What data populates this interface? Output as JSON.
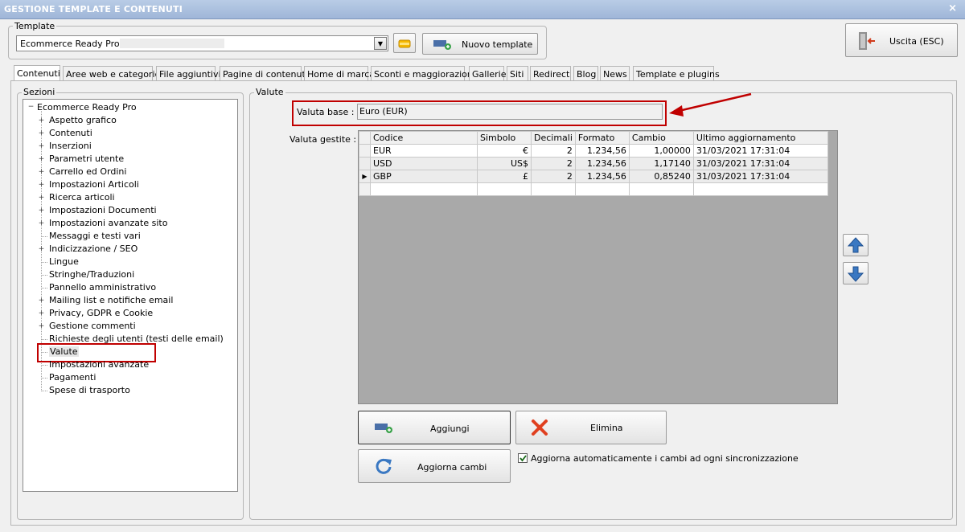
{
  "window": {
    "title": "GESTIONE TEMPLATE E CONTENUTI",
    "close_glyph": "×"
  },
  "template": {
    "group_label": "Template",
    "selected": "Ecommerce Ready Pro",
    "new_label": "Nuovo template",
    "exit_label": "Uscita (ESC)"
  },
  "tabs": [
    "Contenuti",
    "Aree web e categorie",
    "File aggiuntivi",
    "Pagine di contenuti",
    "Home di marca",
    "Sconti e maggiorazioni",
    "Gallerie",
    "Siti",
    "Redirect",
    "Blog",
    "News",
    "Template e plugins"
  ],
  "active_tab": "Contenuti",
  "sections": {
    "label": "Sezioni",
    "root": "Ecommerce Ready Pro",
    "items": [
      {
        "label": "Aspetto grafico",
        "expandable": true
      },
      {
        "label": "Contenuti",
        "expandable": true
      },
      {
        "label": "Inserzioni",
        "expandable": true
      },
      {
        "label": "Parametri utente",
        "expandable": true
      },
      {
        "label": "Carrello ed Ordini",
        "expandable": true
      },
      {
        "label": "Impostazioni Articoli",
        "expandable": true
      },
      {
        "label": "Ricerca articoli",
        "expandable": true
      },
      {
        "label": "Impostazioni Documenti",
        "expandable": true
      },
      {
        "label": "Impostazioni avanzate sito",
        "expandable": true
      },
      {
        "label": "Messaggi e testi vari",
        "expandable": false
      },
      {
        "label": "Indicizzazione / SEO",
        "expandable": true
      },
      {
        "label": "Lingue",
        "expandable": false
      },
      {
        "label": "Stringhe/Traduzioni",
        "expandable": false
      },
      {
        "label": "Pannello amministrativo",
        "expandable": false
      },
      {
        "label": "Mailing list e notifiche email",
        "expandable": true
      },
      {
        "label": "Privacy, GDPR e Cookie",
        "expandable": true
      },
      {
        "label": "Gestione commenti",
        "expandable": true
      },
      {
        "label": "Richieste degli utenti (testi delle email)",
        "expandable": false
      },
      {
        "label": "Valute",
        "expandable": false,
        "selected": true
      },
      {
        "label": "Impostazioni avanzate",
        "expandable": false
      },
      {
        "label": "Pagamenti",
        "expandable": false
      },
      {
        "label": "Spese di trasporto",
        "expandable": false
      }
    ]
  },
  "valute": {
    "group_label": "Valute",
    "base_label": "Valuta base :",
    "base_value": "Euro (EUR)",
    "managed_label": "Valuta gestite :",
    "columns": [
      "Codice",
      "Simbolo",
      "Decimali",
      "Formato",
      "Cambio",
      "Ultimo aggiornamento"
    ],
    "rows": [
      {
        "codice": "EUR",
        "simbolo": "€",
        "decimali": "2",
        "formato": "1.234,56",
        "cambio": "1,00000",
        "aggiornamento": "31/03/2021 17:31:04"
      },
      {
        "codice": "USD",
        "simbolo": "US$",
        "decimali": "2",
        "formato": "1.234,56",
        "cambio": "1,17140",
        "aggiornamento": "31/03/2021 17:31:04"
      },
      {
        "codice": "GBP",
        "simbolo": "£",
        "decimali": "2",
        "formato": "1.234,56",
        "cambio": "0,85240",
        "aggiornamento": "31/03/2021 17:31:04"
      }
    ],
    "add_label": "Aggiungi",
    "delete_label": "Elimina",
    "refresh_label": "Aggiorna cambi",
    "auto_update_label": "Aggiorna automaticamente i cambi ad ogni sincronizzazione",
    "auto_update_checked": true
  },
  "colors": {
    "highlight": "#c00000",
    "accent_blue": "#3a78c2"
  }
}
